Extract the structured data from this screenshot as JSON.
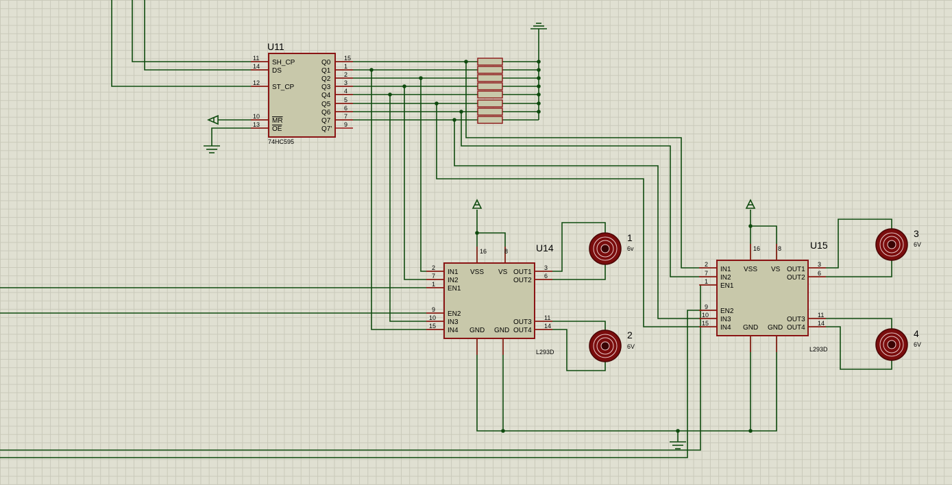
{
  "shift_register": {
    "ref": "U11",
    "part": "74HC595",
    "left_pins": [
      {
        "num": "11",
        "name": "SH_CP"
      },
      {
        "num": "14",
        "name": "DS"
      },
      {
        "num": "12",
        "name": "ST_CP"
      },
      {
        "num": "10",
        "name": "MR"
      },
      {
        "num": "13",
        "name": "OE"
      }
    ],
    "right_pins": [
      {
        "num": "15",
        "name": "Q0"
      },
      {
        "num": "1",
        "name": "Q1"
      },
      {
        "num": "2",
        "name": "Q2"
      },
      {
        "num": "3",
        "name": "Q3"
      },
      {
        "num": "4",
        "name": "Q4"
      },
      {
        "num": "5",
        "name": "Q5"
      },
      {
        "num": "6",
        "name": "Q6"
      },
      {
        "num": "7",
        "name": "Q7"
      },
      {
        "num": "9",
        "name": "Q7'"
      }
    ]
  },
  "drivers": [
    {
      "ref": "U14",
      "part": "L293D",
      "top_pins": [
        {
          "num": "16",
          "name": "VSS"
        },
        {
          "num": "8",
          "name": "VS"
        }
      ],
      "left_pins": [
        {
          "num": "2",
          "name": "IN1"
        },
        {
          "num": "7",
          "name": "IN2"
        },
        {
          "num": "1",
          "name": "EN1"
        },
        {
          "num": "9",
          "name": "EN2"
        },
        {
          "num": "10",
          "name": "IN3"
        },
        {
          "num": "15",
          "name": "IN4"
        }
      ],
      "right_pins": [
        {
          "num": "3",
          "name": "OUT1"
        },
        {
          "num": "6",
          "name": "OUT2"
        },
        {
          "num": "11",
          "name": "OUT3"
        },
        {
          "num": "14",
          "name": "OUT4"
        }
      ],
      "bottom_labels": [
        "GND",
        "GND"
      ]
    },
    {
      "ref": "U15",
      "part": "L293D",
      "top_pins": [
        {
          "num": "16",
          "name": "VSS"
        },
        {
          "num": "8",
          "name": "VS"
        }
      ],
      "left_pins": [
        {
          "num": "2",
          "name": "IN1"
        },
        {
          "num": "7",
          "name": "IN2"
        },
        {
          "num": "1",
          "name": "EN1"
        },
        {
          "num": "9",
          "name": "EN2"
        },
        {
          "num": "10",
          "name": "IN3"
        },
        {
          "num": "15",
          "name": "IN4"
        }
      ],
      "right_pins": [
        {
          "num": "3",
          "name": "OUT1"
        },
        {
          "num": "6",
          "name": "OUT2"
        },
        {
          "num": "11",
          "name": "OUT3"
        },
        {
          "num": "14",
          "name": "OUT4"
        }
      ],
      "bottom_labels": [
        "GND",
        "GND"
      ]
    }
  ],
  "motors": [
    {
      "num": "1",
      "value": "6v"
    },
    {
      "num": "2",
      "value": "6V"
    },
    {
      "num": "3",
      "value": "6V"
    },
    {
      "num": "4",
      "value": "6V"
    }
  ],
  "colors": {
    "background": "#e0e0d2",
    "grid": "#c9c9ba",
    "wire": "#0e4a0e",
    "component_body": "#c8c8aa",
    "component_outline": "#8a1414",
    "motor": "#7a0d0d"
  },
  "icons": [
    "ground-icon",
    "power-icon",
    "dc-motor-icon",
    "resistor-icon"
  ]
}
